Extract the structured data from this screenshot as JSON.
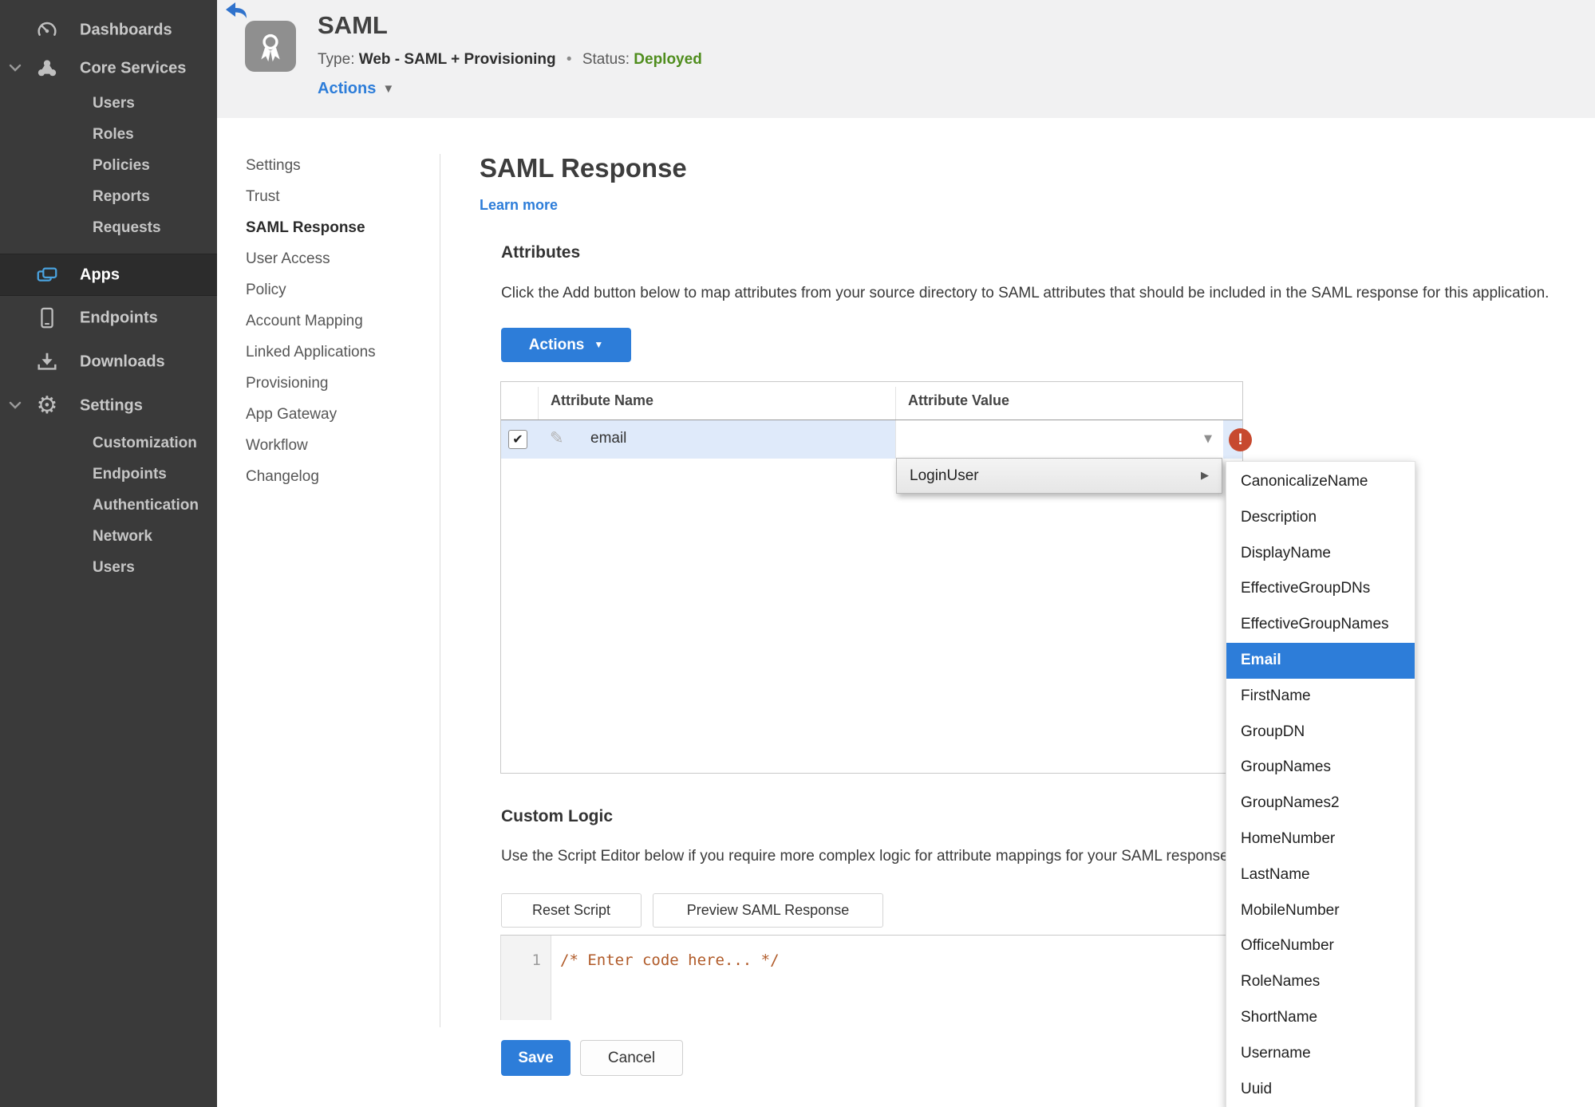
{
  "colors": {
    "accent_blue": "#2d7dd9",
    "status_green": "#4f8d1d",
    "error_red": "#c7492f",
    "row_selected_bg": "#dfeafa",
    "code_comment": "#b05a28"
  },
  "sidebar": {
    "items": [
      {
        "label": "Dashboards",
        "icon": "gauge-icon"
      },
      {
        "label": "Core Services",
        "icon": "cluster-icon",
        "expanded": true
      },
      {
        "label": "Users"
      },
      {
        "label": "Roles"
      },
      {
        "label": "Policies"
      },
      {
        "label": "Reports"
      },
      {
        "label": "Requests"
      },
      {
        "label": "Apps",
        "icon": "apps-icon",
        "active": true
      },
      {
        "label": "Endpoints",
        "icon": "tablet-icon"
      },
      {
        "label": "Downloads",
        "icon": "download-icon"
      },
      {
        "label": "Settings",
        "icon": "gear-icon",
        "expanded": true
      },
      {
        "label": "Customization"
      },
      {
        "label": "Endpoints"
      },
      {
        "label": "Authentication"
      },
      {
        "label": "Network"
      },
      {
        "label": "Users"
      }
    ]
  },
  "header": {
    "title": "SAML",
    "type_label": "Type:",
    "type_value": "Web - SAML + Provisioning",
    "dot": "•",
    "status_label": "Status:",
    "status_value": "Deployed",
    "actions_label": "Actions"
  },
  "app_nav": {
    "items": [
      {
        "label": "Settings"
      },
      {
        "label": "Trust"
      },
      {
        "label": "SAML Response",
        "active": true
      },
      {
        "label": "User Access"
      },
      {
        "label": "Policy"
      },
      {
        "label": "Account Mapping"
      },
      {
        "label": "Linked Applications"
      },
      {
        "label": "Provisioning"
      },
      {
        "label": "App Gateway"
      },
      {
        "label": "Workflow"
      },
      {
        "label": "Changelog"
      }
    ]
  },
  "page": {
    "title": "SAML Response",
    "learn_more": "Learn more"
  },
  "attributes": {
    "heading": "Attributes",
    "description": "Click the Add button below to map attributes from your source directory to SAML attributes that should be included in the SAML response for this application.",
    "actions_button": "Actions",
    "table": {
      "columns": [
        "Attribute Name",
        "Attribute Value"
      ],
      "rows": [
        {
          "checked": true,
          "name": "email",
          "value": "",
          "error": true
        }
      ]
    }
  },
  "value_menu": {
    "root_item": "LoginUser",
    "submenu": {
      "selected": "Email",
      "items": [
        "CanonicalizeName",
        "Description",
        "DisplayName",
        "EffectiveGroupDNs",
        "EffectiveGroupNames",
        "Email",
        "FirstName",
        "GroupDN",
        "GroupNames",
        "GroupNames2",
        "HomeNumber",
        "LastName",
        "MobileNumber",
        "OfficeNumber",
        "RoleNames",
        "ShortName",
        "Username",
        "Uuid"
      ]
    }
  },
  "custom_logic": {
    "heading": "Custom Logic",
    "description": "Use the Script Editor below if you require more complex logic for attribute mappings for your SAML response.",
    "reset_button": "Reset Script",
    "preview_button": "Preview SAML Response",
    "editor": {
      "line_number": "1",
      "code": "/* Enter code here... */"
    }
  },
  "footer": {
    "save_label": "Save",
    "cancel_label": "Cancel"
  }
}
